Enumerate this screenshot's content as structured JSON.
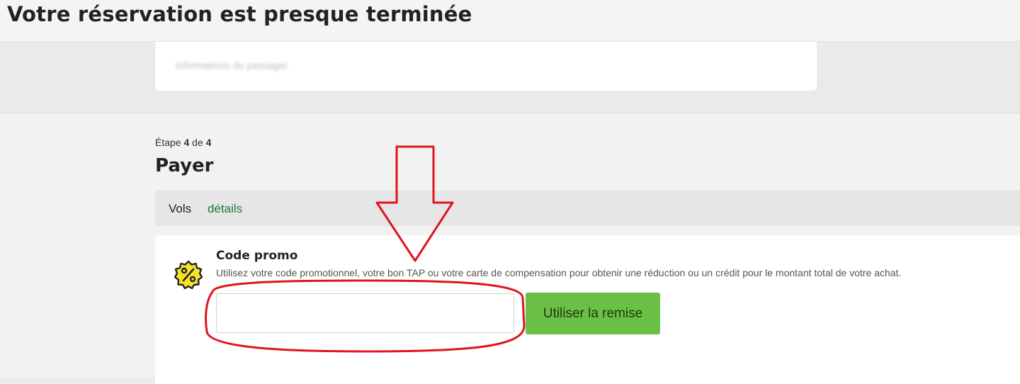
{
  "header": {
    "title": "Votre réservation est presque terminée"
  },
  "previous_section": {
    "redacted_text": "Informations du passager"
  },
  "step": {
    "prefix": "Étape",
    "current": "4",
    "separator": "de",
    "total": "4"
  },
  "page": {
    "title": "Payer"
  },
  "flights_bar": {
    "label": "Vols",
    "details_link": "détails"
  },
  "promo": {
    "icon": "percent-badge-icon",
    "title": "Code promo",
    "description": "Utilisez votre code promotionnel, votre bon TAP ou votre carte de compensation pour obtenir une réduction ou un crédit pour le montant total de votre achat.",
    "input_value": "",
    "apply_button": "Utiliser la remise"
  },
  "colors": {
    "accent_green": "#6abf45",
    "link_green": "#1a7a3a",
    "annotation_red": "#e0141e",
    "badge_yellow": "#f5e32a"
  }
}
